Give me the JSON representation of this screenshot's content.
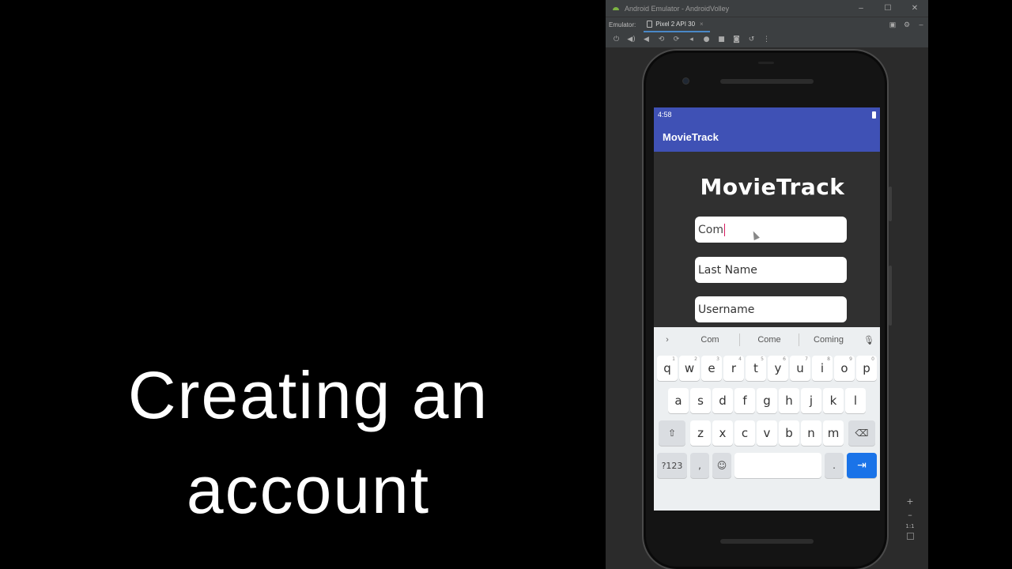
{
  "caption": {
    "line1": "Creating an",
    "line2": "account"
  },
  "emulator": {
    "window_title": "Android Emulator - AndroidVolley",
    "window_controls": [
      "–",
      "☐",
      "✕"
    ],
    "tab_bar_label": "Emulator:",
    "device_tab": "Pixel 2 API 30",
    "tab_close": "×",
    "toolbar_icons": [
      "power-icon",
      "volume-up-icon",
      "volume-down-icon",
      "rotate-left-icon",
      "rotate-right-icon",
      "back-icon",
      "home-icon",
      "overview-icon",
      "screenshot-icon",
      "snapshot-icon",
      "more-icon"
    ],
    "zoom_level": "1:1"
  },
  "phone": {
    "status_time": "4:58",
    "app_bar_title": "MovieTrack",
    "brand_title": "MovieTrack",
    "first_name_value": "Com",
    "last_name_placeholder": "Last Name",
    "username_placeholder": "Username"
  },
  "keyboard": {
    "suggestions": [
      "Com",
      "Come",
      "Coming"
    ],
    "row1": [
      {
        "k": "q",
        "n": "1"
      },
      {
        "k": "w",
        "n": "2"
      },
      {
        "k": "e",
        "n": "3"
      },
      {
        "k": "r",
        "n": "4"
      },
      {
        "k": "t",
        "n": "5"
      },
      {
        "k": "y",
        "n": "6"
      },
      {
        "k": "u",
        "n": "7"
      },
      {
        "k": "i",
        "n": "8"
      },
      {
        "k": "o",
        "n": "9"
      },
      {
        "k": "p",
        "n": "0"
      }
    ],
    "row2": [
      "a",
      "s",
      "d",
      "f",
      "g",
      "h",
      "j",
      "k",
      "l"
    ],
    "row3": [
      "z",
      "x",
      "c",
      "v",
      "b",
      "n",
      "m"
    ],
    "symbols_key": "?123",
    "comma_key": ",",
    "period_key": "."
  }
}
